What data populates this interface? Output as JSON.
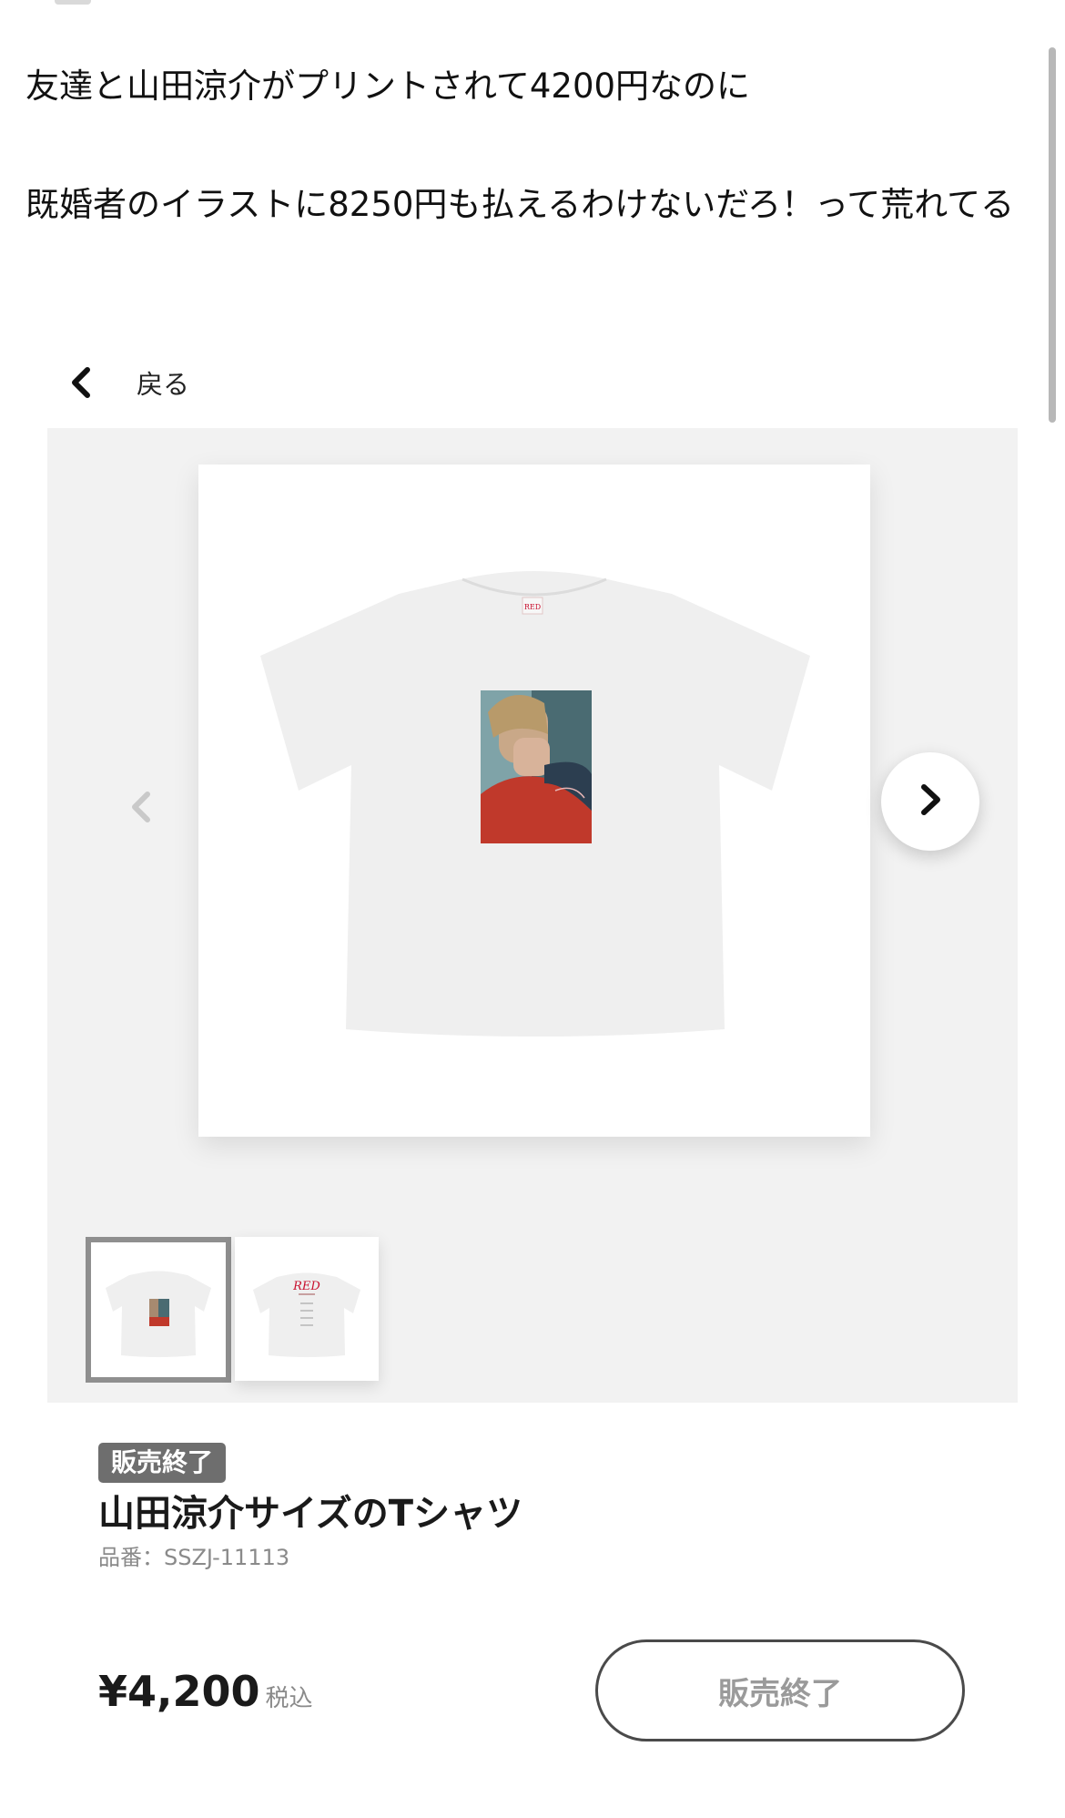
{
  "post": {
    "line1": "友達と山田涼介がプリントされて4200円なのに",
    "line2": "既婚者のイラストに8250円も払えるわけないだろ！って荒れてる"
  },
  "nav": {
    "back_label": "戻る"
  },
  "gallery": {
    "print_logo": "RED",
    "thumbnail_count": 2,
    "selected_thumbnail": 1
  },
  "product": {
    "status_badge": "販売終了",
    "title": "山田涼介サイズのTシャツ",
    "code_line": "品番：SSZJ-11113",
    "price": "¥4,200",
    "tax_label": "税込",
    "action_button": "販売終了"
  },
  "colors": {
    "badge_bg": "#6e6e6e",
    "gallery_bg": "#f2f2f2",
    "print_accent": "#c8102e"
  }
}
